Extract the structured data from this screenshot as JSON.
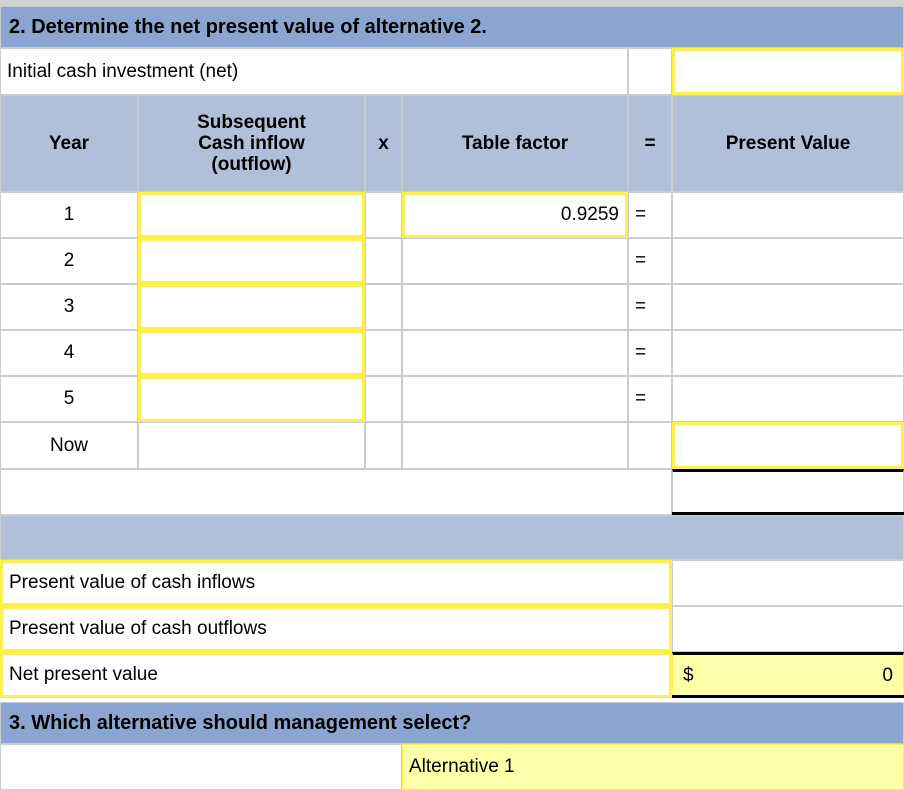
{
  "section2": {
    "title": "2.  Determine the net present value of alternative 2.",
    "initial_investment": {
      "label": "Initial cash investment (net)",
      "value": ""
    },
    "table": {
      "headers": {
        "year": "Year",
        "cash_flow": "Subsequent\nCash inflow\n(outflow)",
        "cash_flow_line1": "Subsequent",
        "cash_flow_line2": "Cash inflow",
        "cash_flow_line3": "(outflow)",
        "times": "x",
        "table_factor": "Table factor",
        "equals": "=",
        "present_value": "Present Value"
      },
      "rows": [
        {
          "year": "1",
          "cash_flow": "",
          "times": "",
          "table_factor": "0.9259",
          "equals": "=",
          "present_value": ""
        },
        {
          "year": "2",
          "cash_flow": "",
          "times": "",
          "table_factor": "",
          "equals": "=",
          "present_value": ""
        },
        {
          "year": "3",
          "cash_flow": "",
          "times": "",
          "table_factor": "",
          "equals": "=",
          "present_value": ""
        },
        {
          "year": "4",
          "cash_flow": "",
          "times": "",
          "table_factor": "",
          "equals": "=",
          "present_value": ""
        },
        {
          "year": "5",
          "cash_flow": "",
          "times": "",
          "table_factor": "",
          "equals": "=",
          "present_value": ""
        },
        {
          "year": "Now",
          "cash_flow": "",
          "times": "",
          "table_factor": "",
          "equals": "",
          "present_value": ""
        }
      ],
      "total_row": {
        "present_value": ""
      }
    },
    "summary": [
      {
        "label": "Present value of cash inflows",
        "value": ""
      },
      {
        "label": "Present value of cash outflows",
        "value": ""
      },
      {
        "label": "Net present value",
        "currency": "$",
        "value": "0"
      }
    ]
  },
  "section3": {
    "title": "3.  Which alternative should management select?",
    "answer": "Alternative 1"
  },
  "colors": {
    "title_bar_blue": "#8aa5d0",
    "header_blue": "#b0c0d8",
    "input_yellow_border": "#ffef4a",
    "filled_yellow": "#ffffaa",
    "grid_gray": "#c8cdd4"
  }
}
